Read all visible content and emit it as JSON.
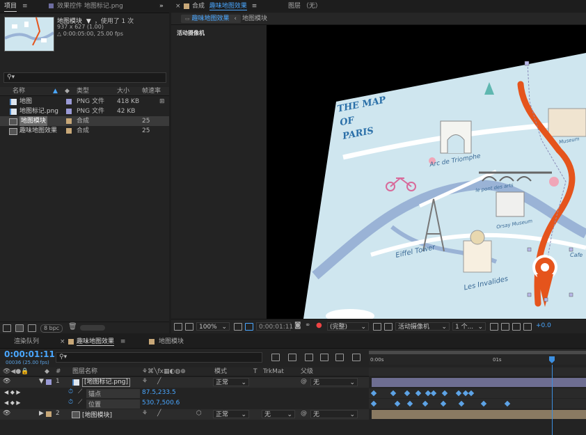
{
  "project_panel": {
    "tab_label": "项目",
    "effects_tab_label": "效果控件 地图标记.png",
    "preview": {
      "name": "地图模块",
      "used": "，使用了 1 次",
      "dimensions": "937 x 627 (1.00)",
      "duration": "△ 0:00:05:00, 25.00 fps"
    },
    "search_placeholder": "",
    "columns": {
      "name": "名称",
      "type": "类型",
      "size": "大小",
      "fps": "帧速率"
    },
    "items": [
      {
        "name": "地图",
        "type": "PNG 文件",
        "size": "418 KB",
        "fps": "",
        "color": "#9a9ad6",
        "icon": "png-file-icon"
      },
      {
        "name": "地图标记.png",
        "type": "PNG 文件",
        "size": "42 KB",
        "fps": "",
        "color": "#9a9ad6",
        "icon": "png-file-icon"
      },
      {
        "name": "地图模块",
        "type": "合成",
        "size": "",
        "fps": "25",
        "color": "#c8a878",
        "icon": "composition-icon",
        "selected": true
      },
      {
        "name": "趣味地图效果",
        "type": "合成",
        "size": "",
        "fps": "25",
        "color": "#c8a878",
        "icon": "composition-icon"
      }
    ],
    "bpc": "8 bpc"
  },
  "comp_panel": {
    "tab_prefix": "合成",
    "tab_name": "趣味地图效果",
    "layer_tab": "图层 （无）",
    "breadcrumbs": [
      "趣味地图效果",
      "地图模块"
    ],
    "camera_label": "活动摄像机",
    "map_title_lines": [
      "THE MAP",
      "OF",
      "PARIS"
    ],
    "map_labels": [
      "Arc de Triomphe",
      "le pont des arts",
      "Orsay Museum",
      "Eiffel Tower",
      "Les Invalides",
      "Cafe",
      "Museum"
    ],
    "footer": {
      "zoom": "100%",
      "timecode": "0:00:01:11",
      "quality": "(完整)",
      "camera": "活动摄像机",
      "views": "1 个...",
      "exposure": "+0.0"
    }
  },
  "timeline": {
    "tabs": [
      "渲染队列",
      "趣味地图效果",
      "地图模块"
    ],
    "timecode": "0:00:01:11",
    "frame_info": "00036 (25.00 fps)",
    "columns": {
      "layer_name": "图层名称",
      "mode": "模式",
      "t": "T",
      "trkmat": "TrkMat",
      "parent": "父级"
    },
    "ruler": [
      "0:00s",
      "01s"
    ],
    "layers": [
      {
        "num": "1",
        "name": "[地图标记.png]",
        "mode": "正常",
        "trkmat": "",
        "parent": "无",
        "color": "#9a9ad6"
      },
      {
        "num": "2",
        "name": "[地图模块]",
        "mode": "正常",
        "trkmat": "无",
        "parent": "无",
        "color": "#c8a878"
      }
    ],
    "properties": [
      {
        "name": "锚点",
        "value": "87.5,233.5"
      },
      {
        "name": "位置",
        "value": "530.7,500.6"
      }
    ]
  },
  "colors": {
    "accent_blue": "#4aa7ff",
    "playhead": "#3c8fe0",
    "map_bg": "#cfe6ef",
    "route": "#e5541c"
  }
}
